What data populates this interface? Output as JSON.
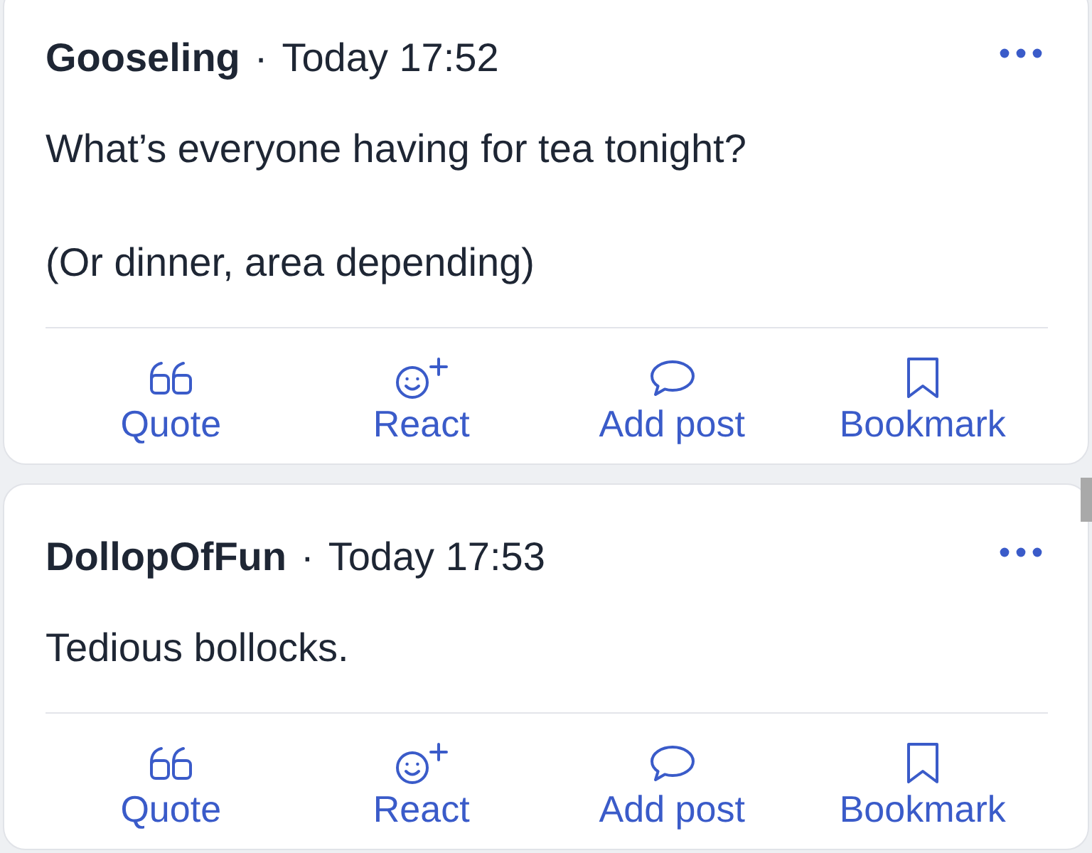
{
  "posts": [
    {
      "author": "Gooseling",
      "separator": "·",
      "time": "Today 17:52",
      "paragraphs": [
        "What’s everyone having for tea tonight?",
        "(Or dinner, area depending)"
      ],
      "actions": [
        {
          "kind": "quote",
          "label": "Quote"
        },
        {
          "kind": "react",
          "label": "React"
        },
        {
          "kind": "add_post",
          "label": "Add post"
        },
        {
          "kind": "bookmark",
          "label": "Bookmark"
        }
      ]
    },
    {
      "author": "DollopOfFun",
      "separator": "·",
      "time": "Today 17:53",
      "paragraphs": [
        "Tedious bollocks."
      ],
      "actions": [
        {
          "kind": "quote",
          "label": "Quote"
        },
        {
          "kind": "react",
          "label": "React"
        },
        {
          "kind": "add_post",
          "label": "Add post"
        },
        {
          "kind": "bookmark",
          "label": "Bookmark"
        }
      ]
    }
  ]
}
